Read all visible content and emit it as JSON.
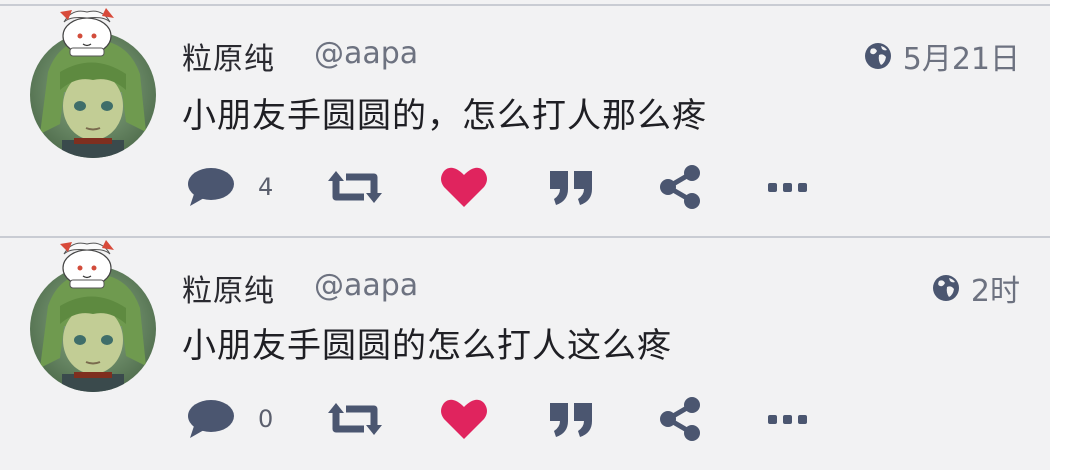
{
  "colors": {
    "icon": "#4b5670",
    "like": "#e0245e",
    "divider": "#c9ccd3",
    "background": "#f2f2f3"
  },
  "posts": [
    {
      "author_name": "粒原纯",
      "handle": "@aapa",
      "time": "5月21日",
      "text": "小朋友手圆圆的，怎么打人那么疼",
      "reply_count": "4",
      "liked": true
    },
    {
      "author_name": "粒原纯",
      "handle": "@aapa",
      "time": "2时",
      "text": "小朋友手圆圆的怎么打人这么疼",
      "reply_count": "0",
      "liked": true
    }
  ],
  "icons": {
    "visibility": "globe-icon",
    "reply": "reply-icon",
    "boost": "boost-icon",
    "like": "heart-icon",
    "quote": "quote-icon",
    "share": "share-icon",
    "more": "more-icon"
  }
}
